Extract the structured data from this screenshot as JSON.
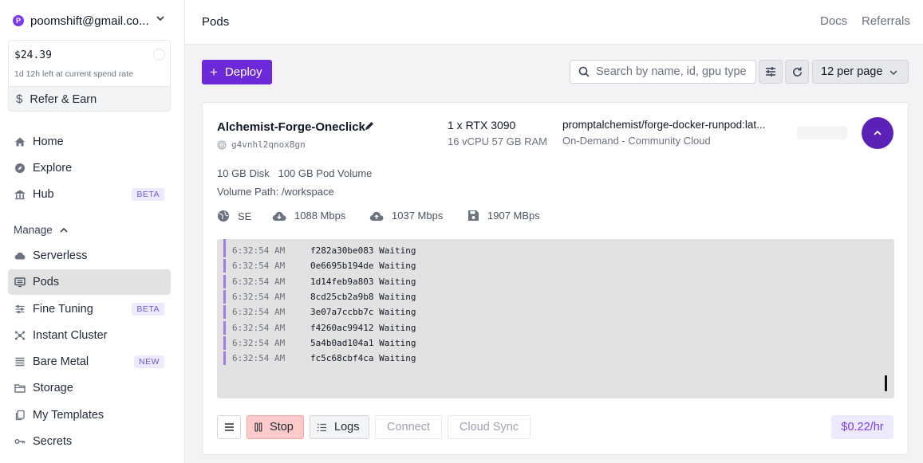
{
  "account": {
    "avatar_letter": "P",
    "email": "poomshift@gmail.co..."
  },
  "balance": {
    "amount": "$24.39",
    "note": "1d 12h left at current spend rate",
    "refer_label": "Refer & Earn",
    "refer_icon": "$"
  },
  "nav": {
    "home": "Home",
    "explore": "Explore",
    "hub": "Hub",
    "hub_badge": "BETA",
    "manage_label": "Manage",
    "serverless": "Serverless",
    "pods": "Pods",
    "fine_tuning": "Fine Tuning",
    "fine_tuning_badge": "BETA",
    "instant_cluster": "Instant Cluster",
    "bare_metal": "Bare Metal",
    "bare_metal_badge": "NEW",
    "storage": "Storage",
    "my_templates": "My Templates",
    "secrets": "Secrets"
  },
  "header": {
    "title": "Pods",
    "docs": "Docs",
    "referrals": "Referrals"
  },
  "toolbar": {
    "deploy_label": "Deploy",
    "search_placeholder": "Search by name, id, gpu type",
    "per_page": "12 per page"
  },
  "pod": {
    "name": "Alchemist-Forge-Oneclick",
    "id": "g4vnhl2qnox8gn",
    "gpu": "1 x RTX 3090",
    "specs": "16 vCPU 57 GB RAM",
    "image": "promptalchemist/forge-docker-runpod:lat...",
    "cloud": "On-Demand - Community Cloud",
    "disk": "10 GB Disk",
    "pod_volume": "100 GB Pod Volume",
    "volume_path": "Volume Path: /workspace",
    "region": "SE",
    "download": "1088 Mbps",
    "upload": "1037 Mbps",
    "disk_speed": "1907 MBps",
    "logs": [
      {
        "time": "6:32:54 AM",
        "msg": "f282a30be083 Waiting"
      },
      {
        "time": "6:32:54 AM",
        "msg": "0e6695b194de Waiting"
      },
      {
        "time": "6:32:54 AM",
        "msg": "1d14feb9a803 Waiting"
      },
      {
        "time": "6:32:54 AM",
        "msg": "8cd25cb2a9b8 Waiting"
      },
      {
        "time": "6:32:54 AM",
        "msg": "3e07a7ccbb7c Waiting"
      },
      {
        "time": "6:32:54 AM",
        "msg": "f4260ac99412 Waiting"
      },
      {
        "time": "6:32:54 AM",
        "msg": "5a4b0ad104a1 Waiting"
      },
      {
        "time": "6:32:54 AM",
        "msg": "fc5c68cbf4ca Waiting"
      }
    ],
    "actions": {
      "stop": "Stop",
      "logs": "Logs",
      "connect": "Connect",
      "cloud_sync": "Cloud Sync"
    },
    "price": "$0.22/hr"
  },
  "colors": {
    "accent": "#6d28d9",
    "stop_bg": "#fecaca",
    "price_bg": "#ede9fe",
    "log_bar": "#9f7aea"
  }
}
